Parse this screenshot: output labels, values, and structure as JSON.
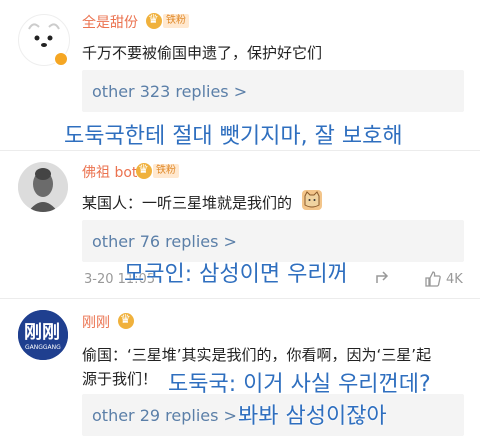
{
  "comments": [
    {
      "username": "全是甜份",
      "badge": "铁粉",
      "text": "千万不要被偷国申遗了，保护好它们",
      "replies": "other 323 replies >",
      "overlay": "도둑국한테 절대 뺏기지마, 잘 보호해"
    },
    {
      "username": "佛祖 bot",
      "badge": "铁粉",
      "text": "某国人：一听三星堆就是我们的",
      "replies": "other 76 replies >",
      "timestamp": "3-20 11:05",
      "likes": "4K",
      "overlay": "모국인: 삼성이면 우리꺼"
    },
    {
      "username": "刚刚",
      "avatar_text": "刚刚",
      "avatar_subtext": "GANGGANG",
      "text_line1": "偷国：‘三星堆’其实是我们的，你看啊，因为‘三星’起",
      "text_line2": "源于我们！",
      "replies": "other 29 replies >",
      "overlay_line1": "도둑국: 이거 사실 우리껀데?",
      "overlay_line2": "봐봐 삼성이잖아"
    }
  ],
  "colors": {
    "username": "#eb7350",
    "replies": "#5b7fa8",
    "overlay": "#2f6fbf"
  }
}
